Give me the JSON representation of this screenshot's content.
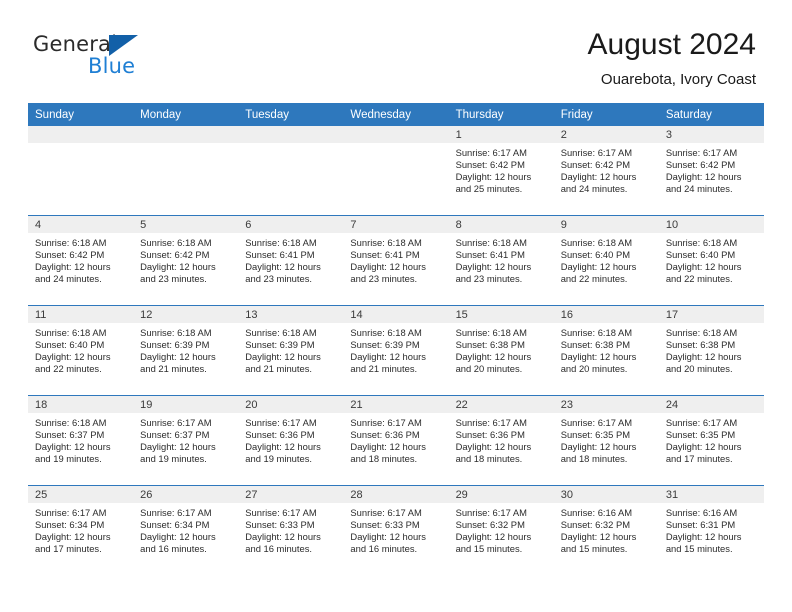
{
  "brand": {
    "name_part1": "General",
    "name_part2": "Blue",
    "triangle_icon": "triangle-icon",
    "colors": {
      "dark": "#2b2b2b",
      "blue": "#1f7fd4",
      "triangle": "#1260a8"
    }
  },
  "header": {
    "title": "August 2024",
    "subtitle": "Ouarebota, Ivory Coast",
    "accent_color": "#2e78bd",
    "daynum_band_color": "#efefef"
  },
  "weekdays": [
    "Sunday",
    "Monday",
    "Tuesday",
    "Wednesday",
    "Thursday",
    "Friday",
    "Saturday"
  ],
  "weeks": [
    [
      {
        "day": "",
        "empty": true,
        "sunrise": "",
        "sunset": "",
        "daylight_line1": "",
        "daylight_line2": ""
      },
      {
        "day": "",
        "empty": true,
        "sunrise": "",
        "sunset": "",
        "daylight_line1": "",
        "daylight_line2": ""
      },
      {
        "day": "",
        "empty": true,
        "sunrise": "",
        "sunset": "",
        "daylight_line1": "",
        "daylight_line2": ""
      },
      {
        "day": "",
        "empty": true,
        "sunrise": "",
        "sunset": "",
        "daylight_line1": "",
        "daylight_line2": ""
      },
      {
        "day": "1",
        "empty": false,
        "sunrise": "Sunrise: 6:17 AM",
        "sunset": "Sunset: 6:42 PM",
        "daylight_line1": "Daylight: 12 hours",
        "daylight_line2": "and 25 minutes."
      },
      {
        "day": "2",
        "empty": false,
        "sunrise": "Sunrise: 6:17 AM",
        "sunset": "Sunset: 6:42 PM",
        "daylight_line1": "Daylight: 12 hours",
        "daylight_line2": "and 24 minutes."
      },
      {
        "day": "3",
        "empty": false,
        "sunrise": "Sunrise: 6:17 AM",
        "sunset": "Sunset: 6:42 PM",
        "daylight_line1": "Daylight: 12 hours",
        "daylight_line2": "and 24 minutes."
      }
    ],
    [
      {
        "day": "4",
        "empty": false,
        "sunrise": "Sunrise: 6:18 AM",
        "sunset": "Sunset: 6:42 PM",
        "daylight_line1": "Daylight: 12 hours",
        "daylight_line2": "and 24 minutes."
      },
      {
        "day": "5",
        "empty": false,
        "sunrise": "Sunrise: 6:18 AM",
        "sunset": "Sunset: 6:42 PM",
        "daylight_line1": "Daylight: 12 hours",
        "daylight_line2": "and 23 minutes."
      },
      {
        "day": "6",
        "empty": false,
        "sunrise": "Sunrise: 6:18 AM",
        "sunset": "Sunset: 6:41 PM",
        "daylight_line1": "Daylight: 12 hours",
        "daylight_line2": "and 23 minutes."
      },
      {
        "day": "7",
        "empty": false,
        "sunrise": "Sunrise: 6:18 AM",
        "sunset": "Sunset: 6:41 PM",
        "daylight_line1": "Daylight: 12 hours",
        "daylight_line2": "and 23 minutes."
      },
      {
        "day": "8",
        "empty": false,
        "sunrise": "Sunrise: 6:18 AM",
        "sunset": "Sunset: 6:41 PM",
        "daylight_line1": "Daylight: 12 hours",
        "daylight_line2": "and 23 minutes."
      },
      {
        "day": "9",
        "empty": false,
        "sunrise": "Sunrise: 6:18 AM",
        "sunset": "Sunset: 6:40 PM",
        "daylight_line1": "Daylight: 12 hours",
        "daylight_line2": "and 22 minutes."
      },
      {
        "day": "10",
        "empty": false,
        "sunrise": "Sunrise: 6:18 AM",
        "sunset": "Sunset: 6:40 PM",
        "daylight_line1": "Daylight: 12 hours",
        "daylight_line2": "and 22 minutes."
      }
    ],
    [
      {
        "day": "11",
        "empty": false,
        "sunrise": "Sunrise: 6:18 AM",
        "sunset": "Sunset: 6:40 PM",
        "daylight_line1": "Daylight: 12 hours",
        "daylight_line2": "and 22 minutes."
      },
      {
        "day": "12",
        "empty": false,
        "sunrise": "Sunrise: 6:18 AM",
        "sunset": "Sunset: 6:39 PM",
        "daylight_line1": "Daylight: 12 hours",
        "daylight_line2": "and 21 minutes."
      },
      {
        "day": "13",
        "empty": false,
        "sunrise": "Sunrise: 6:18 AM",
        "sunset": "Sunset: 6:39 PM",
        "daylight_line1": "Daylight: 12 hours",
        "daylight_line2": "and 21 minutes."
      },
      {
        "day": "14",
        "empty": false,
        "sunrise": "Sunrise: 6:18 AM",
        "sunset": "Sunset: 6:39 PM",
        "daylight_line1": "Daylight: 12 hours",
        "daylight_line2": "and 21 minutes."
      },
      {
        "day": "15",
        "empty": false,
        "sunrise": "Sunrise: 6:18 AM",
        "sunset": "Sunset: 6:38 PM",
        "daylight_line1": "Daylight: 12 hours",
        "daylight_line2": "and 20 minutes."
      },
      {
        "day": "16",
        "empty": false,
        "sunrise": "Sunrise: 6:18 AM",
        "sunset": "Sunset: 6:38 PM",
        "daylight_line1": "Daylight: 12 hours",
        "daylight_line2": "and 20 minutes."
      },
      {
        "day": "17",
        "empty": false,
        "sunrise": "Sunrise: 6:18 AM",
        "sunset": "Sunset: 6:38 PM",
        "daylight_line1": "Daylight: 12 hours",
        "daylight_line2": "and 20 minutes."
      }
    ],
    [
      {
        "day": "18",
        "empty": false,
        "sunrise": "Sunrise: 6:18 AM",
        "sunset": "Sunset: 6:37 PM",
        "daylight_line1": "Daylight: 12 hours",
        "daylight_line2": "and 19 minutes."
      },
      {
        "day": "19",
        "empty": false,
        "sunrise": "Sunrise: 6:17 AM",
        "sunset": "Sunset: 6:37 PM",
        "daylight_line1": "Daylight: 12 hours",
        "daylight_line2": "and 19 minutes."
      },
      {
        "day": "20",
        "empty": false,
        "sunrise": "Sunrise: 6:17 AM",
        "sunset": "Sunset: 6:36 PM",
        "daylight_line1": "Daylight: 12 hours",
        "daylight_line2": "and 19 minutes."
      },
      {
        "day": "21",
        "empty": false,
        "sunrise": "Sunrise: 6:17 AM",
        "sunset": "Sunset: 6:36 PM",
        "daylight_line1": "Daylight: 12 hours",
        "daylight_line2": "and 18 minutes."
      },
      {
        "day": "22",
        "empty": false,
        "sunrise": "Sunrise: 6:17 AM",
        "sunset": "Sunset: 6:36 PM",
        "daylight_line1": "Daylight: 12 hours",
        "daylight_line2": "and 18 minutes."
      },
      {
        "day": "23",
        "empty": false,
        "sunrise": "Sunrise: 6:17 AM",
        "sunset": "Sunset: 6:35 PM",
        "daylight_line1": "Daylight: 12 hours",
        "daylight_line2": "and 18 minutes."
      },
      {
        "day": "24",
        "empty": false,
        "sunrise": "Sunrise: 6:17 AM",
        "sunset": "Sunset: 6:35 PM",
        "daylight_line1": "Daylight: 12 hours",
        "daylight_line2": "and 17 minutes."
      }
    ],
    [
      {
        "day": "25",
        "empty": false,
        "sunrise": "Sunrise: 6:17 AM",
        "sunset": "Sunset: 6:34 PM",
        "daylight_line1": "Daylight: 12 hours",
        "daylight_line2": "and 17 minutes."
      },
      {
        "day": "26",
        "empty": false,
        "sunrise": "Sunrise: 6:17 AM",
        "sunset": "Sunset: 6:34 PM",
        "daylight_line1": "Daylight: 12 hours",
        "daylight_line2": "and 16 minutes."
      },
      {
        "day": "27",
        "empty": false,
        "sunrise": "Sunrise: 6:17 AM",
        "sunset": "Sunset: 6:33 PM",
        "daylight_line1": "Daylight: 12 hours",
        "daylight_line2": "and 16 minutes."
      },
      {
        "day": "28",
        "empty": false,
        "sunrise": "Sunrise: 6:17 AM",
        "sunset": "Sunset: 6:33 PM",
        "daylight_line1": "Daylight: 12 hours",
        "daylight_line2": "and 16 minutes."
      },
      {
        "day": "29",
        "empty": false,
        "sunrise": "Sunrise: 6:17 AM",
        "sunset": "Sunset: 6:32 PM",
        "daylight_line1": "Daylight: 12 hours",
        "daylight_line2": "and 15 minutes."
      },
      {
        "day": "30",
        "empty": false,
        "sunrise": "Sunrise: 6:16 AM",
        "sunset": "Sunset: 6:32 PM",
        "daylight_line1": "Daylight: 12 hours",
        "daylight_line2": "and 15 minutes."
      },
      {
        "day": "31",
        "empty": false,
        "sunrise": "Sunrise: 6:16 AM",
        "sunset": "Sunset: 6:31 PM",
        "daylight_line1": "Daylight: 12 hours",
        "daylight_line2": "and 15 minutes."
      }
    ]
  ]
}
